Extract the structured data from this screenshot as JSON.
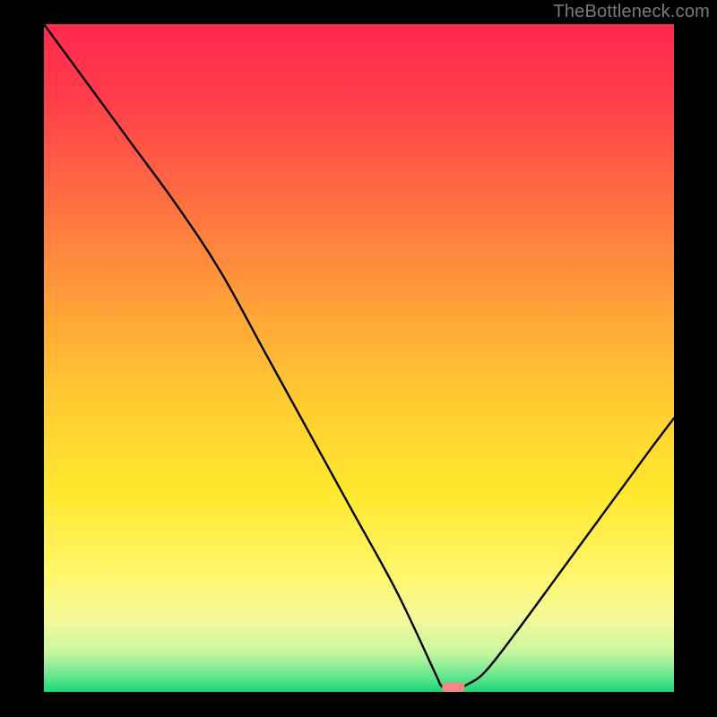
{
  "watermark": {
    "text": "TheBottleneck.com"
  },
  "chart_data": {
    "type": "line",
    "title": "",
    "xlabel": "",
    "ylabel": "",
    "xlim": [
      0,
      100
    ],
    "ylim": [
      0,
      100
    ],
    "x": [
      0,
      7,
      14,
      21,
      28,
      35,
      42,
      49,
      56,
      62,
      63,
      64,
      66,
      67,
      70,
      75,
      82,
      89,
      96,
      100
    ],
    "values": [
      100,
      91,
      82,
      73,
      63,
      51,
      39,
      27,
      15,
      3,
      1,
      0.5,
      0.5,
      1,
      3,
      9,
      18,
      27,
      36,
      41
    ],
    "marker": {
      "x_start": 63.2,
      "x_end": 66.8,
      "y": 0.75,
      "color": "#f08a84"
    },
    "gradient_stops": [
      {
        "offset": 0.0,
        "color": "#ff2a4f"
      },
      {
        "offset": 0.1,
        "color": "#ff3a4a"
      },
      {
        "offset": 0.25,
        "color": "#ff6a42"
      },
      {
        "offset": 0.4,
        "color": "#ff9a3a"
      },
      {
        "offset": 0.55,
        "color": "#ffc832"
      },
      {
        "offset": 0.7,
        "color": "#ffe82e"
      },
      {
        "offset": 0.82,
        "color": "#fff66a"
      },
      {
        "offset": 0.89,
        "color": "#f4fa9a"
      },
      {
        "offset": 0.94,
        "color": "#c8f7a0"
      },
      {
        "offset": 0.975,
        "color": "#6be890"
      },
      {
        "offset": 1.0,
        "color": "#18d673"
      }
    ]
  }
}
